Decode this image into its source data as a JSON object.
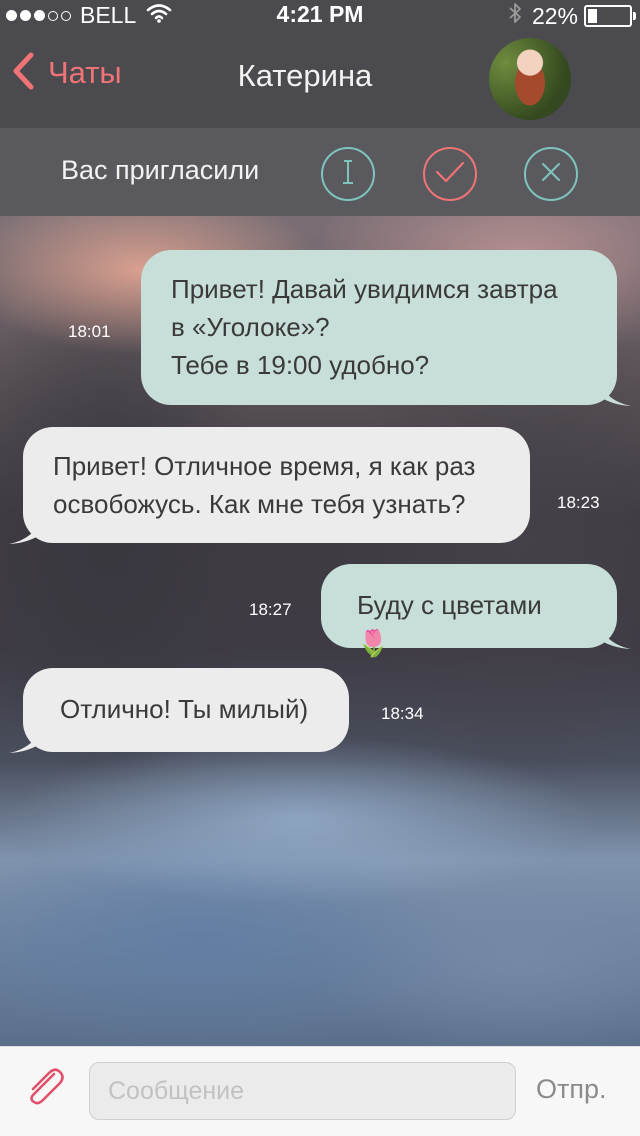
{
  "status_bar": {
    "carrier": "BELL",
    "signal_bars_filled": 3,
    "signal_bars_total": 5,
    "time": "4:21 PM",
    "battery_percent": "22%"
  },
  "nav": {
    "back_label": "Чаты",
    "title": "Катерина",
    "accent_color": "#f07376"
  },
  "invite": {
    "text": "Вас пригласили",
    "info_icon": "info-icon",
    "accept_icon": "check-icon",
    "decline_icon": "close-icon"
  },
  "messages": [
    {
      "direction": "out",
      "text": "Привет! Давай увидимся завтра\nв «Уголоке»?\nТебе в 19:00 удобно?",
      "time": "18:01"
    },
    {
      "direction": "in",
      "text": "Привет! Отличное время, я как раз\nосвобожусь. Как мне тебя узнать?",
      "time": "18:23"
    },
    {
      "direction": "out",
      "text": "Буду с цветами 🌷",
      "time": "18:27"
    },
    {
      "direction": "in",
      "text": "Отлично! Ты милый)",
      "time": "18:34"
    }
  ],
  "composer": {
    "placeholder": "Сообщение",
    "value": "",
    "send_label": "Отпр.",
    "attach_icon": "paperclip-icon"
  },
  "colors": {
    "outgoing_bubble": "#c8ded8",
    "incoming_bubble": "#ececec",
    "teal_outline": "#7fc4bc"
  }
}
